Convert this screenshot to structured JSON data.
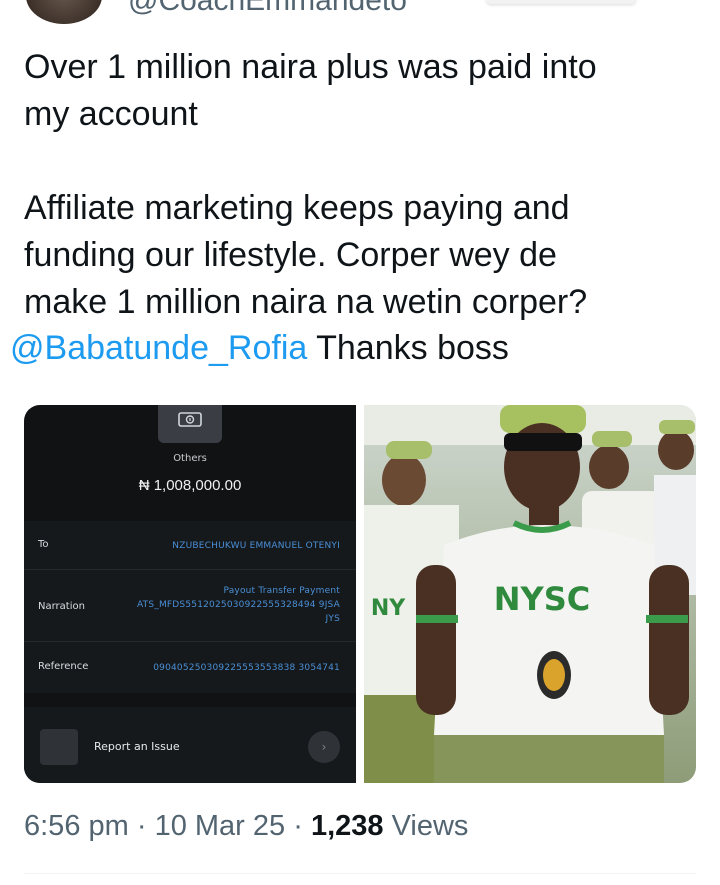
{
  "tweet": {
    "handle": "@CoachEmmandeto",
    "lines": [
      "Over 1 million naira plus was paid into",
      "my account",
      "Affiliate marketing keeps paying and",
      "funding our lifestyle. Corper wey de",
      "make 1 million naira na wetin corper?"
    ],
    "mention": "@Babatunde_Rofia",
    "mention_suffix": " Thanks boss"
  },
  "receipt": {
    "category": "Others",
    "amount": "₦ 1,008,000.00",
    "to_label": "To",
    "to_value": "NZUBECHUKWU EMMANUEL OTENYI",
    "narration_label": "Narration",
    "narration_line1": "Payout Transfer Payment",
    "narration_line2": "ATS_MFDS5512025030922555328494 9JSA",
    "narration_line3": "JYS",
    "reference_label": "Reference",
    "reference_value": "090405250309225553553838 3054741",
    "report_label": "Report an Issue"
  },
  "photo": {
    "shirt_text": "NYSC",
    "side_text": "NY"
  },
  "meta": {
    "time": "6:56 pm",
    "sep1": " · ",
    "date": "10 Mar 25",
    "sep2": " · ",
    "views_count": "1,238",
    "views_label": " Views"
  }
}
